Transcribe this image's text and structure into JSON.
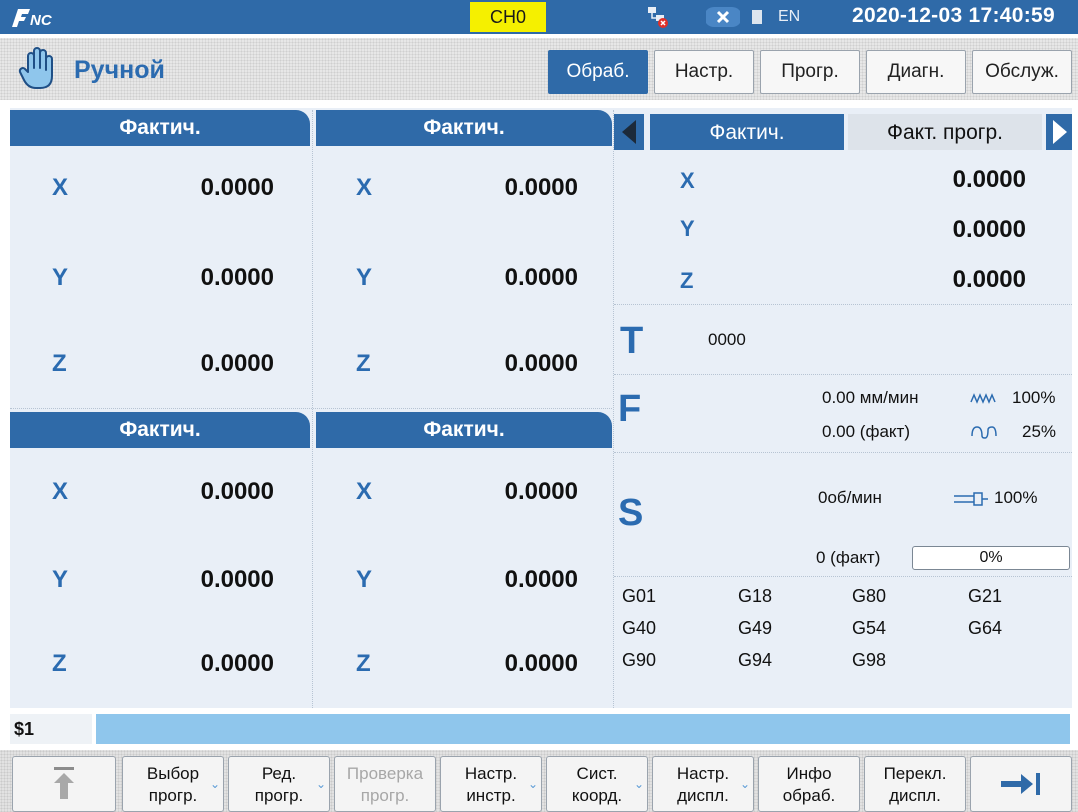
{
  "titlebar": {
    "channel": "CH0",
    "language": "EN",
    "datetime": "2020-12-03 17:40:59"
  },
  "mode": {
    "label": "Ручной",
    "tabs": [
      "Обраб.",
      "Настр.",
      "Прогр.",
      "Диагн.",
      "Обслуж."
    ],
    "active_tab": 0
  },
  "panels": [
    {
      "header": "Фактич.",
      "rows": [
        {
          "axis": "X",
          "value": "0.0000"
        },
        {
          "axis": "Y",
          "value": "0.0000"
        },
        {
          "axis": "Z",
          "value": "0.0000"
        }
      ]
    },
    {
      "header": "Фактич.",
      "rows": [
        {
          "axis": "X",
          "value": "0.0000"
        },
        {
          "axis": "Y",
          "value": "0.0000"
        },
        {
          "axis": "Z",
          "value": "0.0000"
        }
      ]
    },
    {
      "header": "Фактич.",
      "rows": [
        {
          "axis": "X",
          "value": "0.0000"
        },
        {
          "axis": "Y",
          "value": "0.0000"
        },
        {
          "axis": "Z",
          "value": "0.0000"
        }
      ]
    },
    {
      "header": "Фактич.",
      "rows": [
        {
          "axis": "X",
          "value": "0.0000"
        },
        {
          "axis": "Y",
          "value": "0.0000"
        },
        {
          "axis": "Z",
          "value": "0.0000"
        }
      ]
    }
  ],
  "right_panel": {
    "tabs": [
      "Фактич.",
      "Факт. прогр."
    ],
    "rows": [
      {
        "axis": "X",
        "value": "0.0000"
      },
      {
        "axis": "Y",
        "value": "0.0000"
      },
      {
        "axis": "Z",
        "value": "0.0000"
      }
    ],
    "tool": {
      "letter": "T",
      "value": "0000"
    },
    "feed": {
      "letter": "F",
      "line1": "0.00 мм/мин",
      "line2": "0.00 (факт)",
      "override1": "100%",
      "override2": "25%"
    },
    "spindle": {
      "letter": "S",
      "line1": "0об/мин",
      "override": "100%",
      "actual": "0 (факт)",
      "load": "0%",
      "load_fraction": 0.0
    },
    "gcodes": [
      "G01",
      "G18",
      "G80",
      "G21",
      "G40",
      "G49",
      "G54",
      "G64",
      "G90",
      "G94",
      "G98"
    ]
  },
  "command": {
    "label": "$1",
    "value": ""
  },
  "softkeys": [
    {
      "line1": "",
      "line2": "",
      "icon": "up-arrow-icon"
    },
    {
      "line1": "Выбор",
      "line2": "прогр.",
      "chevron": true
    },
    {
      "line1": "Ред.",
      "line2": "прогр.",
      "chevron": true
    },
    {
      "line1": "Проверка",
      "line2": "прогр.",
      "disabled": true
    },
    {
      "line1": "Настр.",
      "line2": "инстр.",
      "chevron": true
    },
    {
      "line1": "Сист.",
      "line2": "коорд.",
      "chevron": true
    },
    {
      "line1": "Настр.",
      "line2": "диспл.",
      "chevron": true
    },
    {
      "line1": "Инфо",
      "line2": "обраб."
    },
    {
      "line1": "Перекл.",
      "line2": "диспл."
    },
    {
      "line1": "",
      "line2": "",
      "icon": "right-arrow-icon"
    }
  ],
  "colors": {
    "accent": "#2f6aa8",
    "axis": "#2b6bb0",
    "panel_bg": "#e9eff7",
    "command_bg": "#8fc6ec",
    "channel_bg": "#f5f000"
  }
}
